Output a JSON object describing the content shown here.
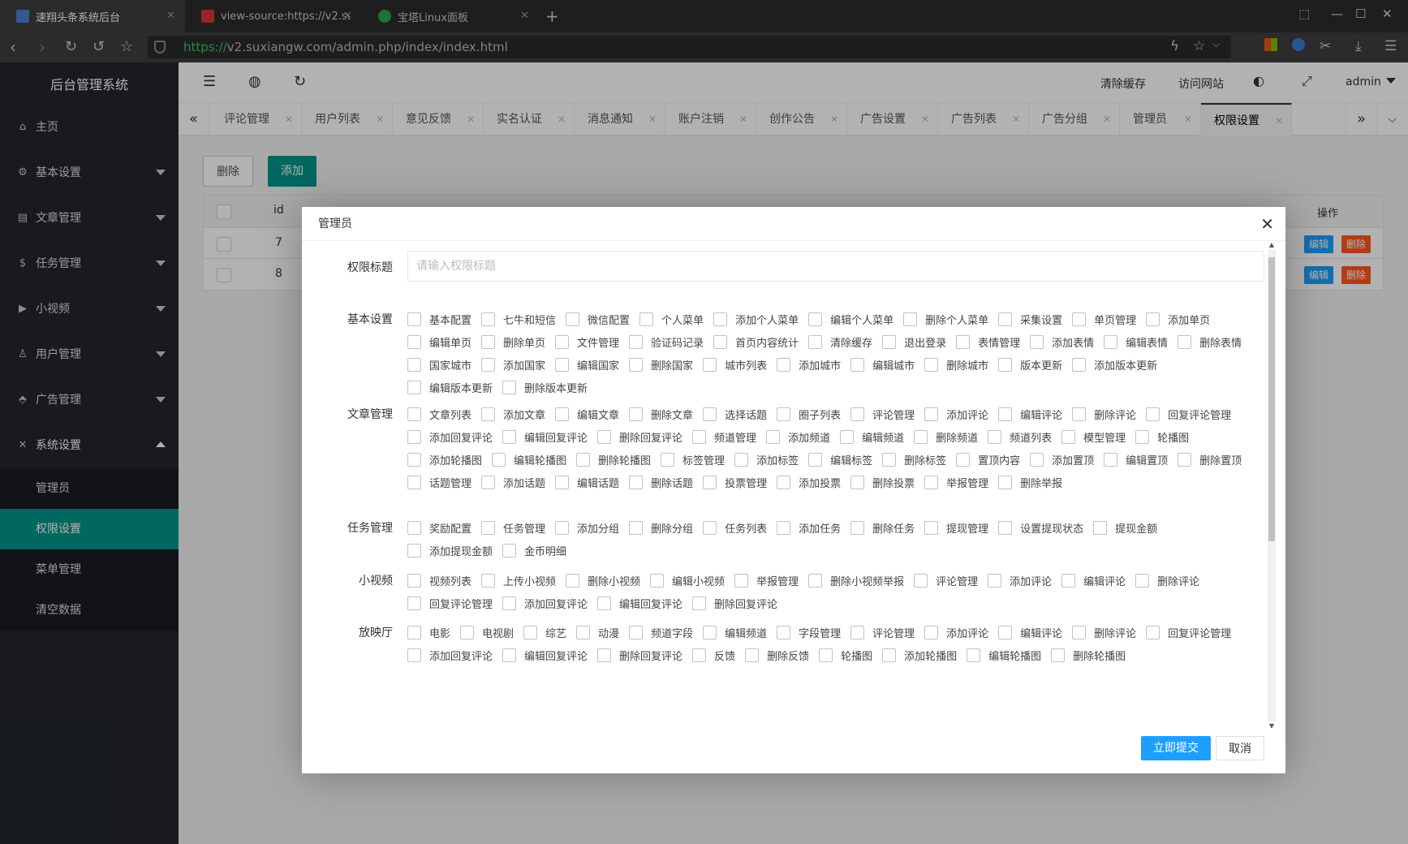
{
  "browser": {
    "tabs": [
      {
        "title": "速翔头条系统后台",
        "active": true
      },
      {
        "title": "view-source:https://v2.suxia",
        "active": false
      },
      {
        "title": "宝塔Linux面板",
        "active": false
      }
    ],
    "url_protocol": "https://",
    "url_rest": "v2.suxiangw.com/admin.php/index/index.html"
  },
  "sidebar": {
    "title": "后台管理系统",
    "items": [
      {
        "label": "主页",
        "icon": "home-icon"
      },
      {
        "label": "基本设置",
        "icon": "gear-icon"
      },
      {
        "label": "文章管理",
        "icon": "document-icon"
      },
      {
        "label": "任务管理",
        "icon": "dollar-icon"
      },
      {
        "label": "小视频",
        "icon": "play-icon"
      },
      {
        "label": "用户管理",
        "icon": "user-icon"
      },
      {
        "label": "广告管理",
        "icon": "tag-icon"
      },
      {
        "label": "系统设置",
        "icon": "tools-icon"
      }
    ],
    "sub_items": [
      "管理员",
      "权限设置",
      "菜单管理",
      "清空数据"
    ]
  },
  "header": {
    "clear_cache": "清除缓存",
    "visit_site": "访问网站",
    "user": "admin"
  },
  "page_tabs": [
    "评论管理",
    "用户列表",
    "意见反馈",
    "实名认证",
    "消息通知",
    "账户注销",
    "创作公告",
    "广告设置",
    "广告列表",
    "广告分组",
    "管理员",
    "权限设置"
  ],
  "content": {
    "delete_btn": "删除",
    "add_btn": "添加",
    "table": {
      "header_id": "id",
      "header_ops": "操作",
      "rows": [
        {
          "id": "7"
        },
        {
          "id": "8"
        }
      ],
      "edit_label": "编辑",
      "delete_label": "删除"
    }
  },
  "modal": {
    "title": "管理员",
    "title_label": "权限标题",
    "title_placeholder": "请输入权限标题",
    "groups": [
      {
        "label": "基本设置",
        "items": [
          "基本配置",
          "七牛和短信",
          "微信配置",
          "个人菜单",
          "添加个人菜单",
          "编辑个人菜单",
          "删除个人菜单",
          "采集设置",
          "单页管理",
          "添加单页",
          "编辑单页",
          "删除单页",
          "文件管理",
          "验证码记录",
          "首页内容统计",
          "清除缓存",
          "退出登录",
          "表情管理",
          "添加表情",
          "编辑表情",
          "删除表情",
          "国家城市",
          "添加国家",
          "编辑国家",
          "删除国家",
          "城市列表",
          "添加城市",
          "编辑城市",
          "删除城市",
          "版本更新",
          "添加版本更新",
          "编辑版本更新",
          "删除版本更新"
        ]
      },
      {
        "label": "文章管理",
        "items": [
          "文章列表",
          "添加文章",
          "编辑文章",
          "删除文章",
          "选择话题",
          "圈子列表",
          "评论管理",
          "添加评论",
          "编辑评论",
          "删除评论",
          "回复评论管理",
          "添加回复评论",
          "编辑回复评论",
          "删除回复评论",
          "频道管理",
          "添加频道",
          "编辑频道",
          "删除频道",
          "频道列表",
          "模型管理",
          "轮播图",
          "添加轮播图",
          "编辑轮播图",
          "删除轮播图",
          "标签管理",
          "添加标签",
          "编辑标签",
          "删除标签",
          "置顶内容",
          "添加置顶",
          "编辑置顶",
          "删除置顶",
          "话题管理",
          "添加话题",
          "编辑话题",
          "删除话题",
          "投票管理",
          "添加投票",
          "删除投票",
          "举报管理",
          "删除举报"
        ]
      },
      {
        "label": "任务管理",
        "items": [
          "奖励配置",
          "任务管理",
          "添加分组",
          "删除分组",
          "任务列表",
          "添加任务",
          "删除任务",
          "提现管理",
          "设置提现状态",
          "提现金额",
          "添加提现金额",
          "金币明细"
        ]
      },
      {
        "label": "小视频",
        "items": [
          "视频列表",
          "上传小视频",
          "删除小视频",
          "编辑小视频",
          "举报管理",
          "删除小视频举报",
          "评论管理",
          "添加评论",
          "编辑评论",
          "删除评论",
          "回复评论管理",
          "添加回复评论",
          "编辑回复评论",
          "删除回复评论"
        ]
      },
      {
        "label": "放映厅",
        "items": [
          "电影",
          "电视剧",
          "综艺",
          "动漫",
          "频道字段",
          "编辑频道",
          "字段管理",
          "评论管理",
          "添加评论",
          "编辑评论",
          "删除评论",
          "回复评论管理",
          "添加回复评论",
          "编辑回复评论",
          "删除回复评论",
          "反馈",
          "删除反馈",
          "轮播图",
          "添加轮播图",
          "编辑轮播图",
          "删除轮播图"
        ]
      }
    ],
    "submit_label": "立即提交",
    "cancel_label": "取消"
  },
  "colors": {
    "accent": "#009688",
    "primary": "#1e9fff",
    "danger": "#ff5722",
    "sidebar_bg": "#23262e"
  }
}
